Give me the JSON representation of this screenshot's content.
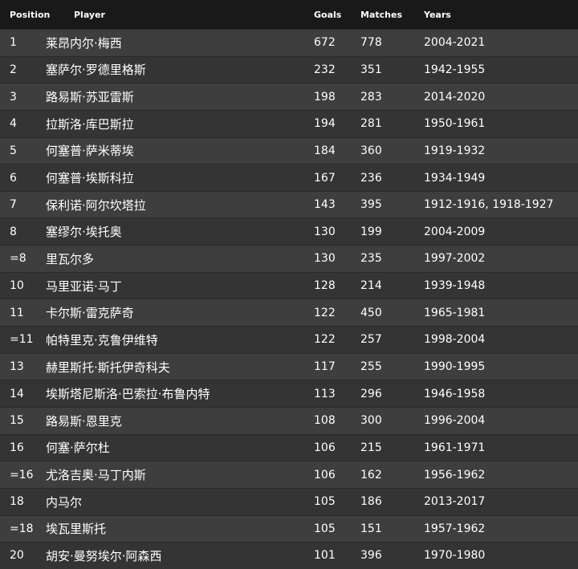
{
  "headers": {
    "position": "Position",
    "player": "Player",
    "goals": "Goals",
    "matches": "Matches",
    "years": "Years"
  },
  "rows": [
    {
      "position": "1",
      "player": "莱昂内尔·梅西",
      "goals": "672",
      "matches": "778",
      "years": "2004-2021"
    },
    {
      "position": "2",
      "player": "塞萨尔·罗德里格斯",
      "goals": "232",
      "matches": "351",
      "years": "1942-1955"
    },
    {
      "position": "3",
      "player": "路易斯·苏亚雷斯",
      "goals": "198",
      "matches": "283",
      "years": "2014-2020"
    },
    {
      "position": "4",
      "player": "拉斯洛·库巴斯拉",
      "goals": "194",
      "matches": "281",
      "years": "1950-1961"
    },
    {
      "position": "5",
      "player": "何塞普·萨米蒂埃",
      "goals": "184",
      "matches": "360",
      "years": "1919-1932"
    },
    {
      "position": "6",
      "player": "何塞普·埃斯科拉",
      "goals": "167",
      "matches": "236",
      "years": "1934-1949"
    },
    {
      "position": "7",
      "player": "保利诺·阿尔坎塔拉",
      "goals": "143",
      "matches": "395",
      "years": "1912-1916, 1918-1927"
    },
    {
      "position": "8",
      "player": "塞缪尔·埃托奥",
      "goals": "130",
      "matches": "199",
      "years": "2004-2009"
    },
    {
      "position": "=8",
      "player": "里瓦尔多",
      "goals": "130",
      "matches": "235",
      "years": "1997-2002"
    },
    {
      "position": "10",
      "player": "马里亚诺·马丁",
      "goals": "128",
      "matches": "214",
      "years": "1939-1948"
    },
    {
      "position": "11",
      "player": "卡尔斯·雷克萨奇",
      "goals": "122",
      "matches": "450",
      "years": "1965-1981"
    },
    {
      "position": "=11",
      "player": "帕特里克·克鲁伊维特",
      "goals": "122",
      "matches": "257",
      "years": "1998-2004"
    },
    {
      "position": "13",
      "player": "赫里斯托·斯托伊奇科夫",
      "goals": "117",
      "matches": "255",
      "years": "1990-1995"
    },
    {
      "position": "14",
      "player": "埃斯塔尼斯洛·巴索拉·布鲁内特",
      "goals": "113",
      "matches": "296",
      "years": "1946-1958"
    },
    {
      "position": "15",
      "player": "路易斯·恩里克",
      "goals": "108",
      "matches": "300",
      "years": "1996-2004"
    },
    {
      "position": "16",
      "player": "何塞·萨尔杜",
      "goals": "106",
      "matches": "215",
      "years": "1961-1971"
    },
    {
      "position": "=16",
      "player": "尤洛吉奥·马丁内斯",
      "goals": "106",
      "matches": "162",
      "years": "1956-1962"
    },
    {
      "position": "18",
      "player": "内马尔",
      "goals": "105",
      "matches": "186",
      "years": "2013-2017"
    },
    {
      "position": "=18",
      "player": "埃瓦里斯托",
      "goals": "105",
      "matches": "151",
      "years": "1957-1962"
    },
    {
      "position": "20",
      "player": "胡安·曼努埃尔·阿森西",
      "goals": "101",
      "matches": "396",
      "years": "1970-1980"
    }
  ]
}
